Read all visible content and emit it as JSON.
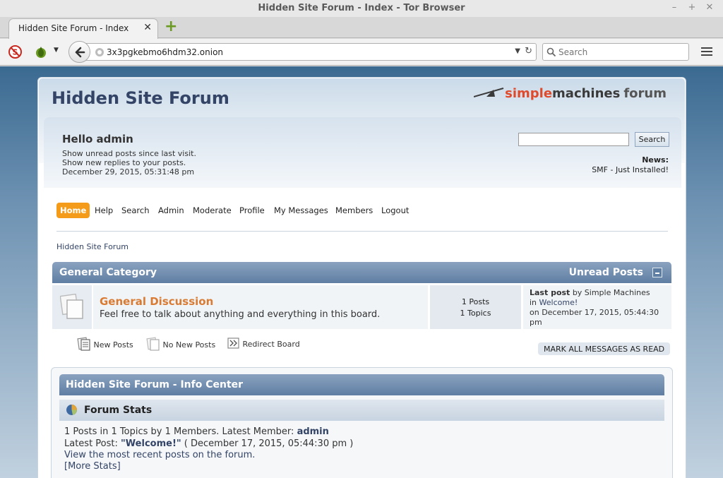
{
  "browser": {
    "window_title": "Hidden Site Forum - Index - Tor Browser",
    "tab_title": "Hidden Site Forum - Index",
    "url": "3x3pgkebmo6hdm32.onion",
    "search_placeholder": "Search"
  },
  "forum": {
    "title": "Hidden Site Forum",
    "logo": {
      "part1": "simple",
      "part2": "machines",
      "part3": "forum"
    },
    "user": {
      "greeting": "Hello admin",
      "unread_link": "Show unread posts since last visit.",
      "replies_link": "Show new replies to your posts.",
      "datetime": "December 29, 2015, 05:31:48 pm"
    },
    "search_button": "Search",
    "news_label": "News:",
    "news_text": "SMF - Just Installed!",
    "menu": [
      "Home",
      "Help",
      "Search",
      "Admin",
      "Moderate",
      "Profile",
      "My Messages",
      "Members",
      "Logout"
    ],
    "breadcrumb": "Hidden Site Forum",
    "category": {
      "title": "General Category",
      "unread": "Unread Posts"
    },
    "board": {
      "name": "General Discussion",
      "description": "Feel free to talk about anything and everything in this board.",
      "posts": "1 Posts",
      "topics": "1 Topics",
      "last_post_label": "Last post",
      "last_post_by": "by Simple Machines",
      "last_post_in": "in",
      "last_post_topic": "Welcome!",
      "last_post_date": "on December 17, 2015, 05:44:30 pm"
    },
    "legend": {
      "new_posts": "New Posts",
      "no_new_posts": "No New Posts",
      "redirect": "Redirect Board"
    },
    "mark_read_button": "MARK ALL MESSAGES AS READ",
    "info_center": {
      "title": "Hidden Site Forum - Info Center",
      "stats_title": "Forum Stats",
      "stats_text": "1 Posts in 1 Topics by 1 Members. Latest Member:",
      "latest_member": "admin",
      "latest_post_label": "Latest Post:",
      "latest_post_title": "\"Welcome!\"",
      "latest_post_date": "( December 17, 2015, 05:44:30 pm )",
      "recent_link": "View the most recent posts on the forum.",
      "more_stats": "[More Stats]"
    }
  },
  "colors": {
    "accent": "#f49c1a",
    "board_link": "#d97b33",
    "header_blue": "#5f7ea3",
    "smf_red": "#e04a2c"
  }
}
